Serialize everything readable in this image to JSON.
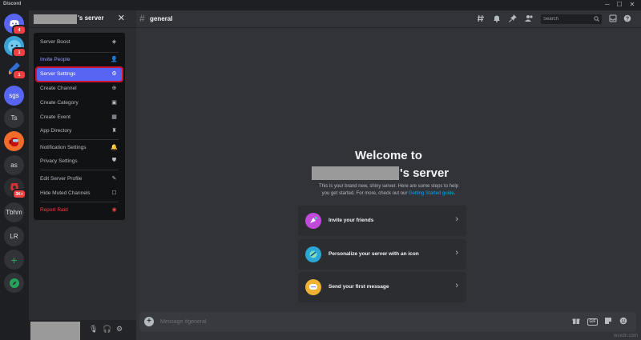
{
  "titlebar": {
    "app_name": "Discord",
    "minimize": "─",
    "maximize": "☐",
    "close": "✕"
  },
  "rail": {
    "servers": [
      {
        "label": "",
        "icon": "discord-home-icon",
        "badge": "4"
      },
      {
        "label": "",
        "icon": "blue-face-server-icon",
        "badge": "1"
      },
      {
        "label": "",
        "icon": "arrow-server-icon",
        "badge": "1"
      },
      {
        "label": "sgs",
        "badge": ""
      },
      {
        "label": "Ts",
        "badge": ""
      },
      {
        "label": "",
        "icon": "among-us-server-icon",
        "badge": ""
      },
      {
        "label": "as",
        "badge": ""
      },
      {
        "label": "",
        "icon": "red-server-icon",
        "badge": "3K+"
      },
      {
        "label": "Tbhm",
        "badge": ""
      },
      {
        "label": "LR",
        "badge": ""
      }
    ],
    "add_server": "+",
    "explore": "⊘",
    "colors": {
      "add": "#23a559",
      "sgs": "#5865f2"
    }
  },
  "server": {
    "name_suffix": "'s server",
    "close_icon": "✕"
  },
  "menu": {
    "items": [
      {
        "label": "Server Boost",
        "icon": "boost-icon",
        "glyph": "◈",
        "style": "normal"
      },
      {
        "label": "Invite People",
        "icon": "invite-person-icon",
        "glyph": "👤",
        "style": "accent"
      },
      {
        "label": "Server Settings",
        "icon": "gear-icon",
        "glyph": "⚙",
        "style": "selected"
      },
      {
        "label": "Create Channel",
        "icon": "plus-circle-icon",
        "glyph": "⊕",
        "style": "normal"
      },
      {
        "label": "Create Category",
        "icon": "folder-plus-icon",
        "glyph": "▣",
        "style": "normal"
      },
      {
        "label": "Create Event",
        "icon": "calendar-plus-icon",
        "glyph": "▦",
        "style": "normal"
      },
      {
        "label": "App Directory",
        "icon": "robot-icon",
        "glyph": "♜",
        "style": "normal"
      },
      {
        "label": "Notification Settings",
        "icon": "bell-icon",
        "glyph": "🔔",
        "style": "normal"
      },
      {
        "label": "Privacy Settings",
        "icon": "shield-icon",
        "glyph": "⛊",
        "style": "normal"
      },
      {
        "label": "Edit Server Profile",
        "icon": "pencil-icon",
        "glyph": "✎",
        "style": "normal"
      },
      {
        "label": "Hide Muted Channels",
        "icon": "checkbox-icon",
        "glyph": "☐",
        "style": "normal"
      },
      {
        "label": "Report Raid",
        "icon": "report-raid-icon",
        "glyph": "◉",
        "style": "danger"
      }
    ]
  },
  "userpanel": {
    "mic": "🎙",
    "headphones": "🎧",
    "settings": "⚙"
  },
  "channel": {
    "hash": "#",
    "name": "general",
    "header_icons": [
      "threads-icon",
      "bell-icon",
      "pin-icon",
      "members-icon"
    ],
    "search_placeholder": "Search",
    "search_icon": "🔍",
    "inbox": "▭",
    "help": "?"
  },
  "welcome": {
    "line1": "Welcome to",
    "line2_suffix": "'s server",
    "desc_line1": "This is your brand new, shiny server. Here are some steps to help",
    "desc_line2_pre": "you get started. For more, check out our ",
    "desc_link": "Getting Started guide",
    "desc_line2_post": ".",
    "cards": [
      {
        "label": "Invite your friends",
        "icon": "invite-friends-icon",
        "color": "#c04bdb"
      },
      {
        "label": "Personalize your server with an icon",
        "icon": "personalize-icon",
        "color": "#2aa7d6"
      },
      {
        "label": "Send your first message",
        "icon": "first-message-icon",
        "color": "#f0b232"
      }
    ],
    "chevron": "›"
  },
  "composer": {
    "placeholder": "Message #general",
    "plus": "+",
    "gif": "GIF",
    "gift": "🎁",
    "sticker": "▤",
    "emoji": "☺"
  },
  "watermark": "wsxdn.com"
}
